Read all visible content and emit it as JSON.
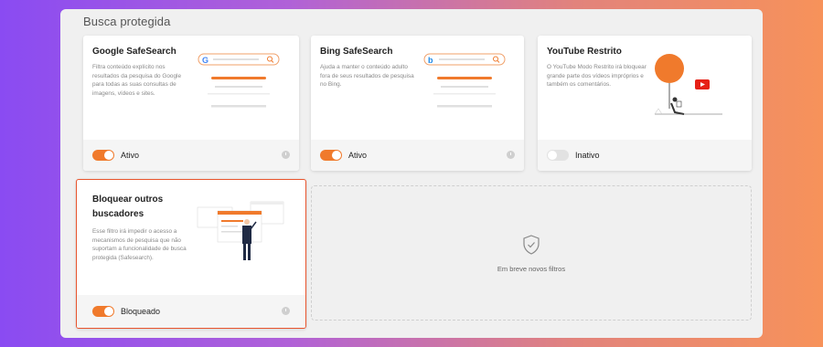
{
  "panel": {
    "title": "Busca protegida"
  },
  "cards": [
    {
      "title": "Google SafeSearch",
      "description": "Filtra conteúdo explícito nos resultados da pesquisa do Google para todas as suas consultas de imagens, vídeos e sites.",
      "status": "Ativo",
      "enabled": true,
      "logo_letter": "G",
      "logo_color": "#4285f4"
    },
    {
      "title": "Bing SafeSearch",
      "description": "Ajuda a manter o conteúdo adulto fora de seus resultados de pesquisa no Bing.",
      "status": "Ativo",
      "enabled": true,
      "logo_letter": "b",
      "logo_color": "#1e88e5"
    },
    {
      "title": "YouTube Restrito",
      "description": "O YouTube Modo Restrito irá bloquear grande parte dos vídeos impróprios e também os comentários.",
      "status": "Inativo",
      "enabled": false
    },
    {
      "title": "Bloquear outros buscadores",
      "description": "Esse filtro irá impedir o acesso a mecanismos de pesquisa que não suportam a funcionalidade de busca protegida (Safesearch).",
      "status": "Bloqueado",
      "enabled": true
    }
  ],
  "placeholder": {
    "label": "Em breve novos filtros"
  },
  "colors": {
    "accent": "#f07a2c",
    "selected_border": "#e8542d",
    "youtube_red": "#e62117"
  }
}
